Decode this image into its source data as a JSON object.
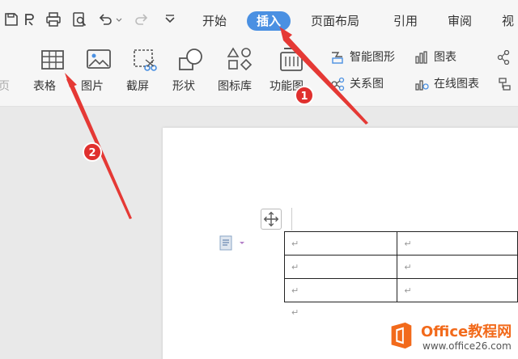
{
  "menu_tabs": [
    "开始",
    "插入",
    "页面布局",
    "引用",
    "审阅",
    "视"
  ],
  "ribbon_tools": [
    "表格",
    "图片",
    "截屏",
    "形状",
    "图标库",
    "功能图"
  ],
  "ribbon_side": [
    "智能图形",
    "图表",
    "关系图",
    "在线图表"
  ],
  "left_partial_label": "页",
  "callouts": [
    "1",
    "2"
  ],
  "doc_table_marks": [
    "↵",
    "↵",
    "↵",
    "↵",
    "↵",
    "↵"
  ],
  "after_table_mark": "↵",
  "watermark": {
    "brand": "Office教程网",
    "url": "www.office26.com"
  },
  "colors": {
    "accent": "#4a90e2",
    "arrow": "#e53935",
    "logo_orange": "#f26a1b"
  }
}
